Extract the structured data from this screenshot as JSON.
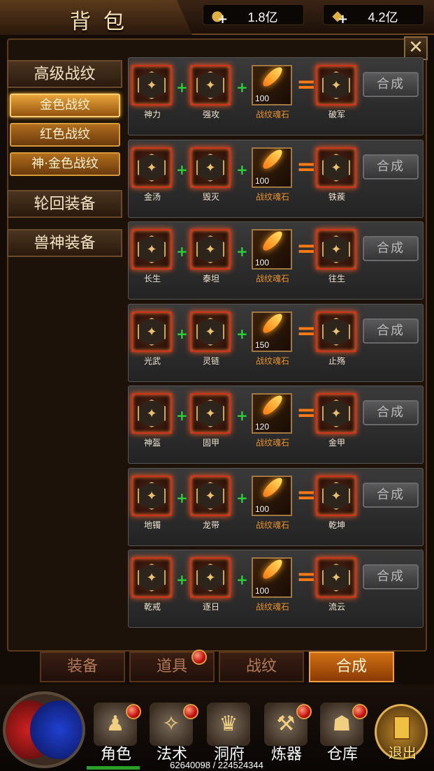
{
  "header": {
    "title": "背包",
    "currencies": [
      {
        "icon": "coins-icon",
        "value": "1.8亿"
      },
      {
        "icon": "gold-ingot-icon",
        "value": "4.2亿"
      }
    ]
  },
  "sidebar": {
    "categories": [
      {
        "label": "高级战纹"
      },
      {
        "label": "轮回装备"
      },
      {
        "label": "兽神装备"
      }
    ],
    "subitems": [
      {
        "label": "金色战纹",
        "active": true
      },
      {
        "label": "红色战纹",
        "active": false
      },
      {
        "label": "神·金色战纹",
        "active": false
      }
    ]
  },
  "recipes": [
    {
      "in1": "神力",
      "in2": "强攻",
      "stone_label": "战纹魂石",
      "stone_count": "100",
      "out": "破军",
      "button": "合成"
    },
    {
      "in1": "金汤",
      "in2": "毁灭",
      "stone_label": "战纹魂石",
      "stone_count": "100",
      "out": "铁蒺",
      "button": "合成"
    },
    {
      "in1": "长生",
      "in2": "泰坦",
      "stone_label": "战纹魂石",
      "stone_count": "100",
      "out": "往生",
      "button": "合成"
    },
    {
      "in1": "光武",
      "in2": "灵链",
      "stone_label": "战纹魂石",
      "stone_count": "150",
      "out": "止殇",
      "button": "合成"
    },
    {
      "in1": "神盔",
      "in2": "固甲",
      "stone_label": "战纹魂石",
      "stone_count": "120",
      "out": "金甲",
      "button": "合成"
    },
    {
      "in1": "地镯",
      "in2": "龙带",
      "stone_label": "战纹魂石",
      "stone_count": "100",
      "out": "乾坤",
      "button": "合成"
    },
    {
      "in1": "乾戒",
      "in2": "逐日",
      "stone_label": "战纹魂石",
      "stone_count": "100",
      "out": "流云",
      "button": "合成"
    }
  ],
  "symbols": {
    "plus": "+",
    "equals": "=",
    "close": "✕"
  },
  "tabs": [
    {
      "label": "装备",
      "active": false
    },
    {
      "label": "道具",
      "active": false
    },
    {
      "label": "战纹",
      "active": false
    },
    {
      "label": "合成",
      "active": true
    }
  ],
  "nav": [
    {
      "label": "角色",
      "icon": "character-icon"
    },
    {
      "label": "法术",
      "icon": "spell-icon"
    },
    {
      "label": "洞府",
      "icon": "cave-icon"
    },
    {
      "label": "炼器",
      "icon": "forge-icon"
    },
    {
      "label": "仓库",
      "icon": "warehouse-icon"
    }
  ],
  "exit_label": "退出",
  "experience": "62640098 / 224524344",
  "colors": {
    "accent": "#e9a53a",
    "active_tab": "#d07012",
    "plus": "#2ad23a",
    "equals": "#ff7a14"
  }
}
